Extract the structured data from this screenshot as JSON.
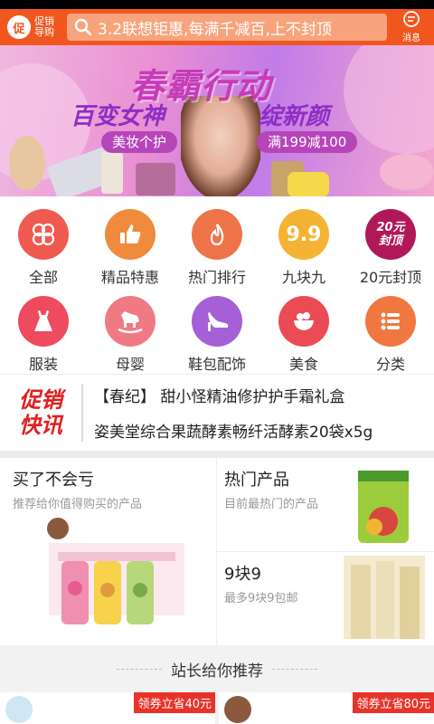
{
  "header": {
    "logo_mark": "促",
    "logo_line1": "促销",
    "logo_line2": "导购",
    "search_text": "3.2联想钜惠,每满千减百,上不封顶",
    "message_label": "消息"
  },
  "banner": {
    "title": "春霸行动",
    "left_slogan": "百变女神",
    "right_slogan": "绽新颜",
    "pill_left": "美妆个护",
    "pill_right": "满199减100"
  },
  "categories": [
    {
      "label": "全部",
      "icon": "clover-icon",
      "color": "#f0594f"
    },
    {
      "label": "精品特惠",
      "icon": "thumbs-up-icon",
      "color": "#f08a3c"
    },
    {
      "label": "热门排行",
      "icon": "flame-icon",
      "color": "#ef7348"
    },
    {
      "label": "九块九",
      "icon": "nine-nine-icon",
      "badge": "9.9",
      "color": "#f4b333"
    },
    {
      "label": "20元封顶",
      "icon": "twenty-cap-icon",
      "badge": "20元 封顶",
      "color": "#b1185a"
    },
    {
      "label": "服装",
      "icon": "dress-icon",
      "color": "#ee4b5e"
    },
    {
      "label": "母婴",
      "icon": "rocking-horse-icon",
      "color": "#f07a84"
    },
    {
      "label": "鞋包配饰",
      "icon": "high-heel-icon",
      "color": "#a560d8"
    },
    {
      "label": "美食",
      "icon": "bowl-icon",
      "color": "#ea4b55"
    },
    {
      "label": "分类",
      "icon": "list-icon",
      "color": "#f0773f"
    }
  ],
  "news": {
    "logo_line1": "促销",
    "logo_line2": "快讯",
    "items": [
      "【春纪】 甜小怪精油修护护手霜礼盒",
      "姿美堂综合果蔬酵素畅纤活酵素20袋x5g"
    ]
  },
  "features": {
    "left": {
      "title": "买了不会亏",
      "subtitle": "推荐给你值得购买的产品"
    },
    "hot": {
      "title": "热门产品",
      "subtitle": "目前最热门的产品"
    },
    "nine": {
      "title": "9块9",
      "subtitle": "最多9块9包邮"
    }
  },
  "recommend_title": "站长给你推荐",
  "products": [
    {
      "coupon": "领券立省40元"
    },
    {
      "coupon": "领券立省80元"
    }
  ]
}
